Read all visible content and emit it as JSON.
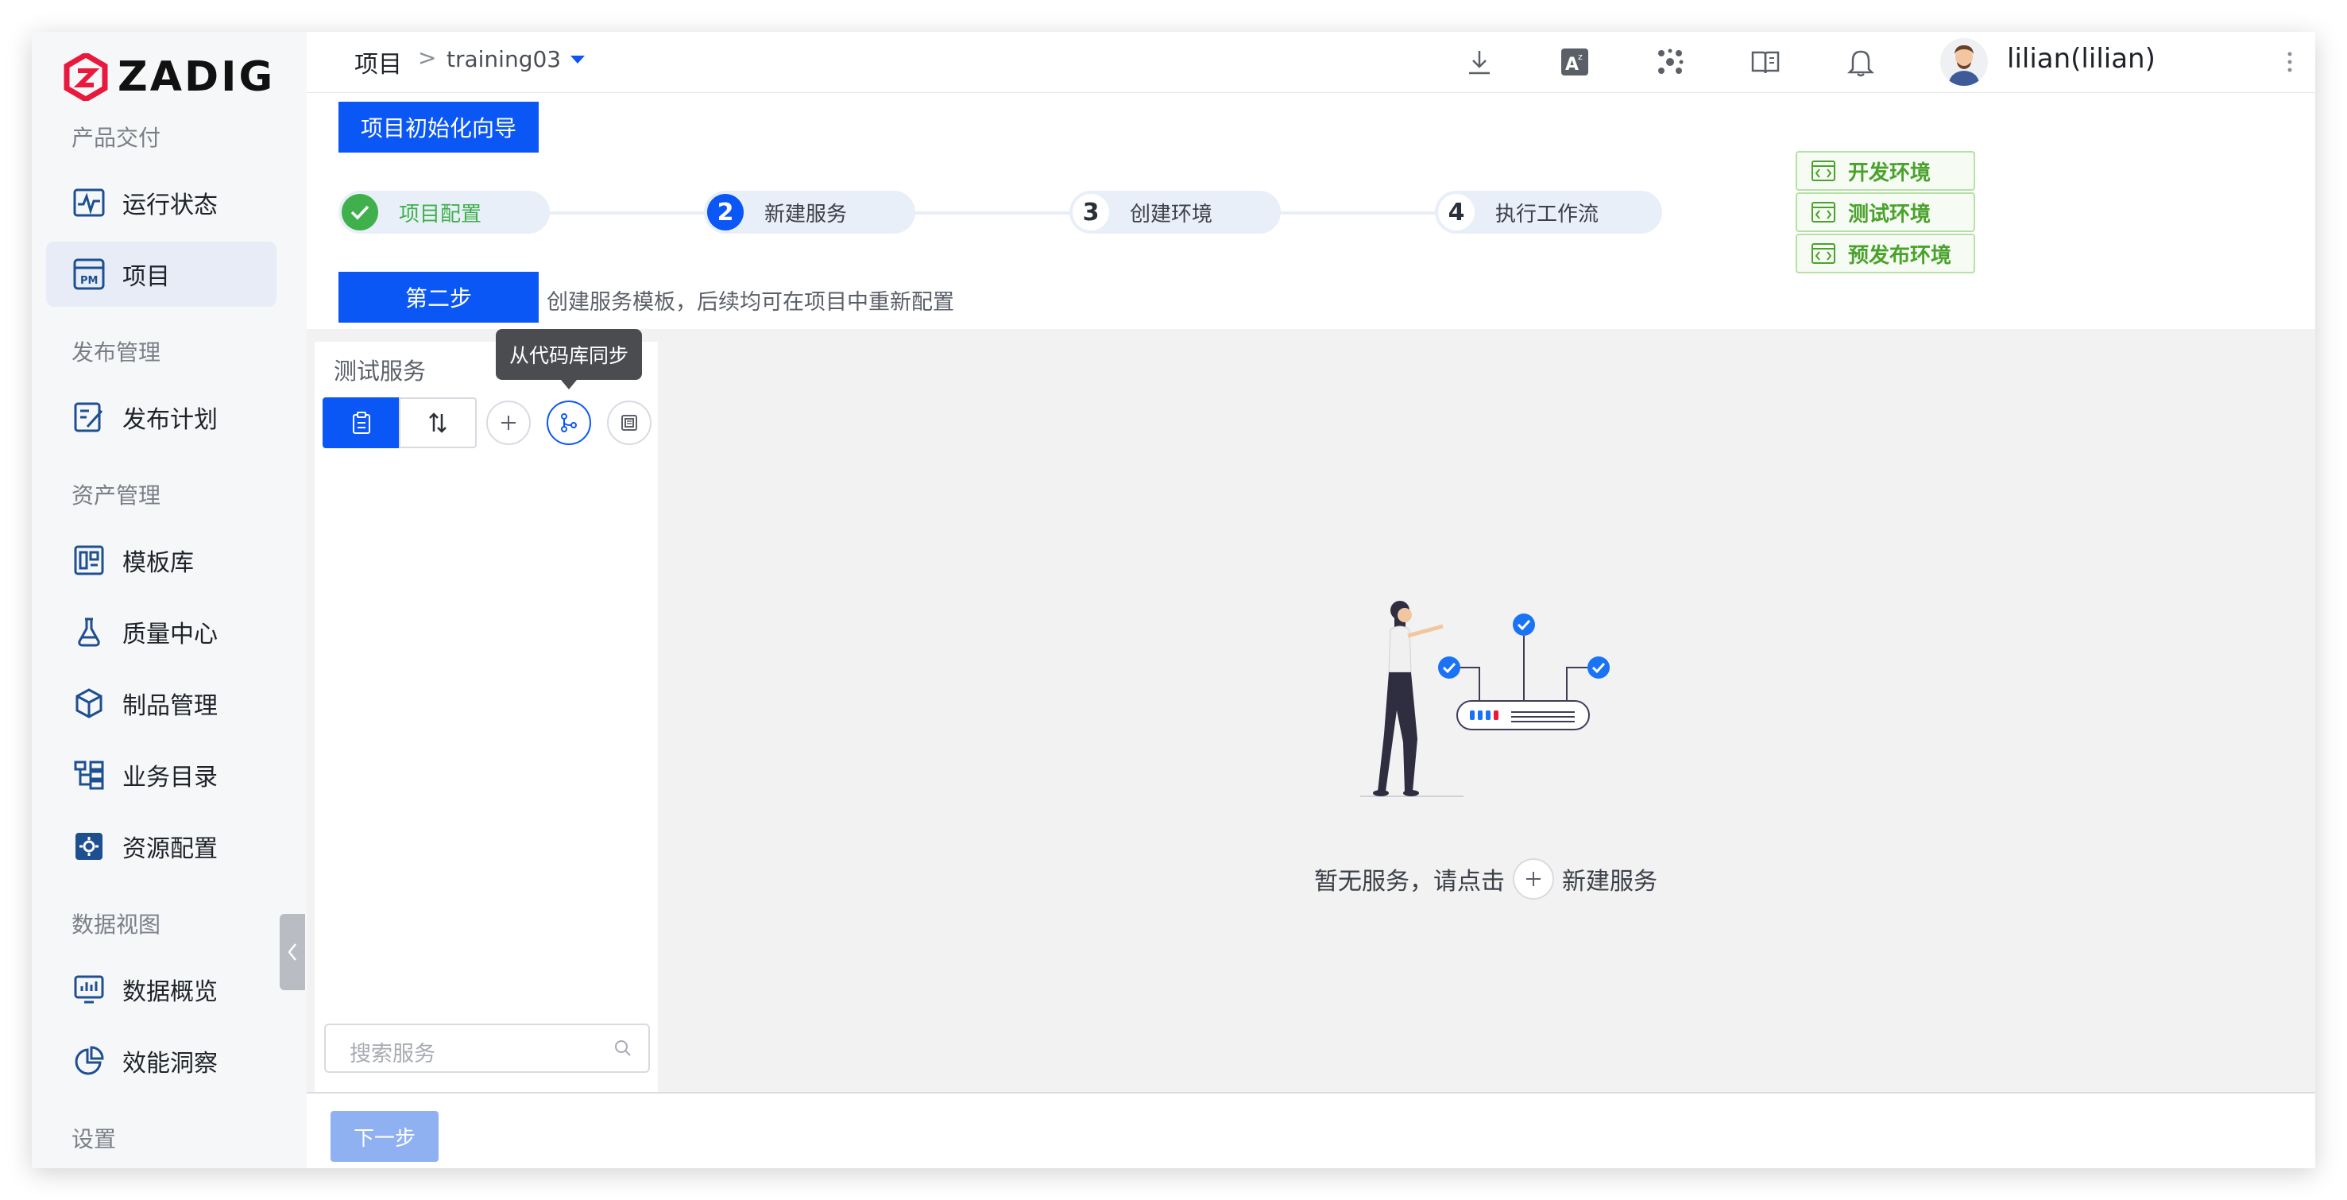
{
  "brand": {
    "name": "ZADIG",
    "color": "#e8193c"
  },
  "sidebar": {
    "groups": {
      "delivery": "产品交付",
      "release": "发布管理",
      "assets": "资产管理",
      "data": "数据视图",
      "settings": "设置"
    },
    "items": [
      {
        "label": "运行状态",
        "icon": "pulse-icon"
      },
      {
        "label": "项目",
        "icon": "project-pm-icon",
        "active": true
      },
      {
        "label": "发布计划",
        "icon": "release-plan-icon"
      },
      {
        "label": "模板库",
        "icon": "template-icon"
      },
      {
        "label": "质量中心",
        "icon": "flask-icon"
      },
      {
        "label": "制品管理",
        "icon": "package-icon"
      },
      {
        "label": "业务目录",
        "icon": "catalog-icon"
      },
      {
        "label": "资源配置",
        "icon": "gear-box-icon"
      },
      {
        "label": "数据概览",
        "icon": "dashboard-icon"
      },
      {
        "label": "效能洞察",
        "icon": "pie-icon"
      }
    ]
  },
  "header": {
    "breadcrumb_root": "项目",
    "breadcrumb_sep": ">",
    "project": "training03",
    "username": "lilian(lilian)",
    "icons": [
      "download-icon",
      "translate-icon",
      "plugins-icon",
      "docs-icon",
      "bell-icon",
      "more-icon"
    ]
  },
  "wizard": {
    "title": "项目初始化向导",
    "steps": [
      {
        "num": "",
        "label": "项目配置",
        "state": "done"
      },
      {
        "num": "2",
        "label": "新建服务",
        "state": "active"
      },
      {
        "num": "3",
        "label": "创建环境",
        "state": "todo"
      },
      {
        "num": "4",
        "label": "执行工作流",
        "state": "todo"
      }
    ],
    "envs": [
      "开发环境",
      "测试环境",
      "预发布环境"
    ],
    "step_tag": "第二步",
    "step_desc": "创建服务模板，后续均可在项目中重新配置"
  },
  "services": {
    "title": "测试服务",
    "tooltip": "从代码库同步",
    "search_placeholder": "搜索服务"
  },
  "empty": {
    "prefix": "暂无服务，请点击",
    "suffix": "新建服务"
  },
  "footer": {
    "next_label": "下一步"
  },
  "colors": {
    "primary": "#0a57f5",
    "success": "#4aa22c",
    "next_disabled": "#8fb1f2"
  }
}
